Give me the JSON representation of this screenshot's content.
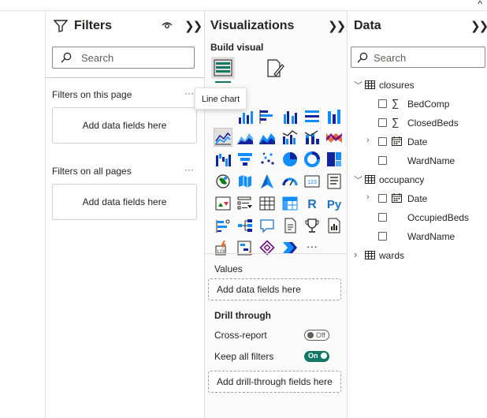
{
  "filters": {
    "title": "Filters",
    "search_placeholder": "Search",
    "on_this_page": "Filters on this page",
    "on_all_pages": "Filters on all pages",
    "well_label": "Add data fields here",
    "more": "···"
  },
  "viz": {
    "title": "Visualizations",
    "build_visual": "Build visual",
    "tooltip": "Line chart",
    "values_label": "Values",
    "values_well": "Add data fields here",
    "drill_title": "Drill through",
    "cross_report": "Cross-report",
    "cross_report_state": "Off",
    "keep_filters": "Keep all filters",
    "keep_filters_state": "On",
    "drill_well": "Add drill-through fields here",
    "more_visuals": "···",
    "icons": [
      "line-chart-icon",
      "area-chart-icon",
      "stacked-area-chart-icon",
      "line-clustered-column-icon",
      "line-stacked-column-icon",
      "ribbon-chart-icon",
      "waterfall-chart-icon",
      "funnel-chart-icon",
      "scatter-chart-icon",
      "pie-chart-icon",
      "donut-chart-icon",
      "treemap-icon",
      "map-icon",
      "filled-map-icon",
      "azure-map-icon",
      "gauge-icon",
      "card-icon",
      "multi-row-card-icon",
      "kpi-icon",
      "slicer-icon",
      "table-icon",
      "matrix-icon",
      "r-visual-icon",
      "python-visual-icon",
      "key-influencers-icon",
      "decomposition-tree-icon",
      "qna-icon",
      "narrative-icon",
      "metrics-icon",
      "paginated-report-icon",
      "power-apps-icon",
      "power-automate-icon",
      "diamond-visual-icon",
      "arrow-chevron-icon"
    ]
  },
  "data": {
    "title": "Data",
    "search_placeholder": "Search",
    "tables": [
      {
        "name": "closures",
        "fields": [
          "BedComp",
          "ClosedBeds",
          "Date",
          "WardName"
        ]
      },
      {
        "name": "occupancy",
        "fields": [
          "Date",
          "OccupiedBeds",
          "WardName"
        ]
      },
      {
        "name": "wards",
        "fields": []
      }
    ]
  },
  "colors": {
    "accent_teal": "#117865",
    "chart_blue": "#118dff",
    "chart_dark": "#12239e",
    "chart_orange": "#e66c37",
    "chart_purple": "#6b007b"
  }
}
